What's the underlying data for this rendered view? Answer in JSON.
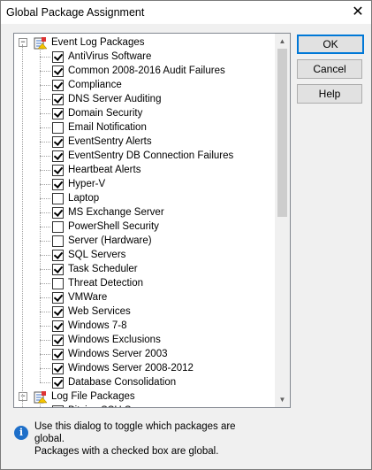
{
  "window": {
    "title": "Global Package Assignment",
    "close_glyph": "✕"
  },
  "tree": {
    "groups": [
      {
        "label": "Event Log Packages",
        "expander": "−",
        "icon": "event-log-packages-icon",
        "items": [
          {
            "label": "AntiVirus Software",
            "checked": true
          },
          {
            "label": "Common 2008-2016 Audit Failures",
            "checked": true
          },
          {
            "label": "Compliance",
            "checked": true
          },
          {
            "label": "DNS Server Auditing",
            "checked": true
          },
          {
            "label": "Domain Security",
            "checked": true
          },
          {
            "label": "Email Notification",
            "checked": false
          },
          {
            "label": "EventSentry Alerts",
            "checked": true
          },
          {
            "label": "EventSentry DB Connection Failures",
            "checked": true
          },
          {
            "label": "Heartbeat Alerts",
            "checked": true
          },
          {
            "label": "Hyper-V",
            "checked": true
          },
          {
            "label": "Laptop",
            "checked": false
          },
          {
            "label": "MS Exchange Server",
            "checked": true
          },
          {
            "label": "PowerShell Security",
            "checked": false
          },
          {
            "label": "Server (Hardware)",
            "checked": false
          },
          {
            "label": "SQL Servers",
            "checked": true
          },
          {
            "label": "Task Scheduler",
            "checked": true
          },
          {
            "label": "Threat Detection",
            "checked": false
          },
          {
            "label": "VMWare",
            "checked": true
          },
          {
            "label": "Web Services",
            "checked": true
          },
          {
            "label": "Windows 7-8",
            "checked": true
          },
          {
            "label": "Windows Exclusions",
            "checked": true
          },
          {
            "label": "Windows Server 2003",
            "checked": true
          },
          {
            "label": "Windows Server 2008-2012",
            "checked": true
          },
          {
            "label": "Database Consolidation",
            "checked": true
          }
        ]
      },
      {
        "label": "Log File Packages",
        "expander": "−",
        "icon": "log-file-packages-icon",
        "items": [
          {
            "label": "Bitvise SSH Server",
            "checked": true
          }
        ]
      }
    ]
  },
  "buttons": {
    "ok": "OK",
    "cancel": "Cancel",
    "help": "Help"
  },
  "info": {
    "icon_glyph": "i",
    "line1": "Use this dialog to toggle which packages are global.",
    "line2": "Packages with a checked box are global."
  },
  "colors": {
    "accent": "#0078d7",
    "info_icon": "#1e6fc9"
  }
}
